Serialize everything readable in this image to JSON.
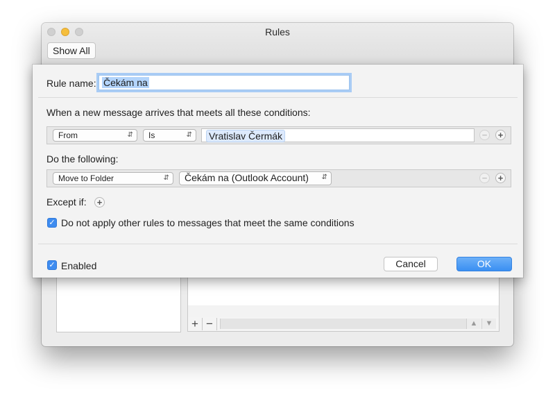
{
  "window": {
    "title": "Rules",
    "show_all_label": "Show All"
  },
  "rule": {
    "name_label": "Rule name:",
    "name_value": "Čekám na",
    "conditions_heading": "When a new message arrives that meets all these conditions:",
    "condition": {
      "field": "From",
      "operator": "Is",
      "value": "Vratislav Čermák"
    },
    "actions_heading": "Do the following:",
    "action": {
      "type": "Move to Folder",
      "target": "Čekám na (Outlook Account)"
    },
    "except_label": "Except if:",
    "no_other_rules": {
      "label": "Do not apply other rules to messages that meet the same conditions",
      "checked": true
    },
    "enabled": {
      "label": "Enabled",
      "checked": true
    },
    "cancel_label": "Cancel",
    "ok_label": "OK"
  },
  "list": {
    "add_label": "+",
    "remove_label": "−"
  },
  "colors": {
    "accent": "#3e8cf0",
    "ok_button": "#4a97f4",
    "minimize_button": "#f5be3c"
  }
}
